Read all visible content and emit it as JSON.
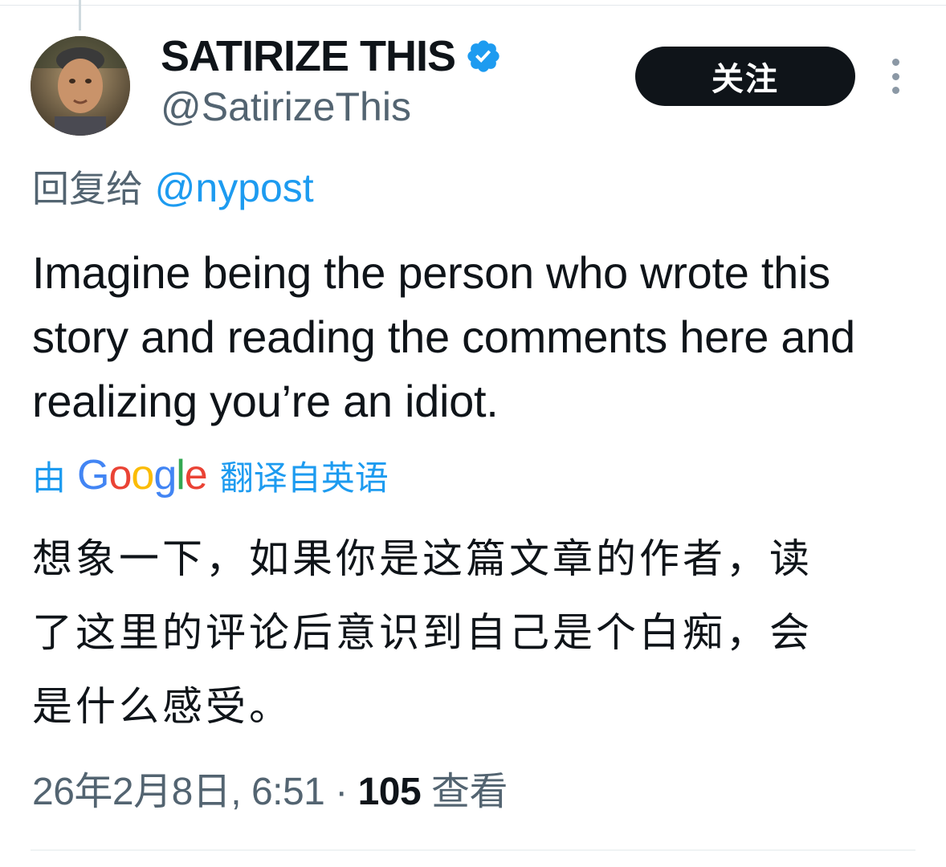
{
  "tweet": {
    "display_name": "SATIRIZE THIS",
    "handle": "@SatirizeThis",
    "follow_label": "关注",
    "reply_prefix": "回复给",
    "reply_to": "@nypost",
    "text": "Imagine being the person who wrote this story and reading the comments here and realizing you’re an idiot.",
    "translation": {
      "prefix": "由",
      "provider": "Google",
      "suffix": "翻译自英语",
      "text": "想象一下，如果你是这篇文章的作者，读了这里的评论后意识到自己是个白痴，会是什么感受。"
    },
    "timestamp": "26年2月8日, 6:51",
    "separator": "·",
    "views_count": "105",
    "views_label": "查看"
  },
  "colors": {
    "accent": "#1d9bf0",
    "text": "#0f1419",
    "secondary_text": "#536471",
    "follow_button_bg": "#0f1419"
  },
  "icons": {
    "verified": "verified-badge-icon",
    "more": "more-vertical-icon"
  }
}
